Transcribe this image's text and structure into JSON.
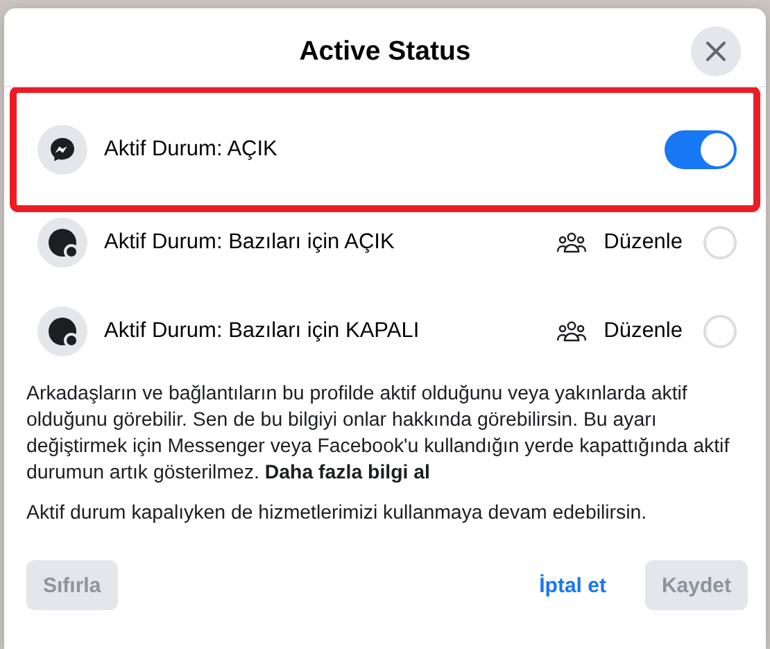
{
  "dialog": {
    "title": "Active Status"
  },
  "rows": [
    {
      "kind": "toggle",
      "label": "Aktif Durum: AÇIK",
      "on": true,
      "highlighted": true
    },
    {
      "kind": "radio",
      "label": "Aktif Durum: Bazıları için AÇIK",
      "edit": "Düzenle",
      "selected": false,
      "highlighted": false
    },
    {
      "kind": "radio",
      "label": "Aktif Durum: Bazıları için KAPALI",
      "edit": "Düzenle",
      "selected": false,
      "highlighted": false
    }
  ],
  "info": {
    "text": "Arkadaşların ve bağlantıların bu profilde aktif olduğunu veya yakınlarda aktif olduğunu görebilir. Sen de bu bilgiyi onlar hakkında görebilirsin. Bu ayarı değiştirmek için Messenger veya Facebook'u kullandığın yerde kapattığında aktif durumun artık gösterilmez.",
    "link": "Daha fazla bilgi al",
    "note": "Aktif durum kapalıyken de hizmetlerimizi kullanmaya devam edebilirsin."
  },
  "buttons": [
    {
      "label": "Sıfırla",
      "kind": "filled",
      "disabled": true
    },
    {
      "label": "İptal et",
      "kind": "text",
      "disabled": false
    },
    {
      "label": "Kaydet",
      "kind": "filled",
      "disabled": true
    }
  ]
}
